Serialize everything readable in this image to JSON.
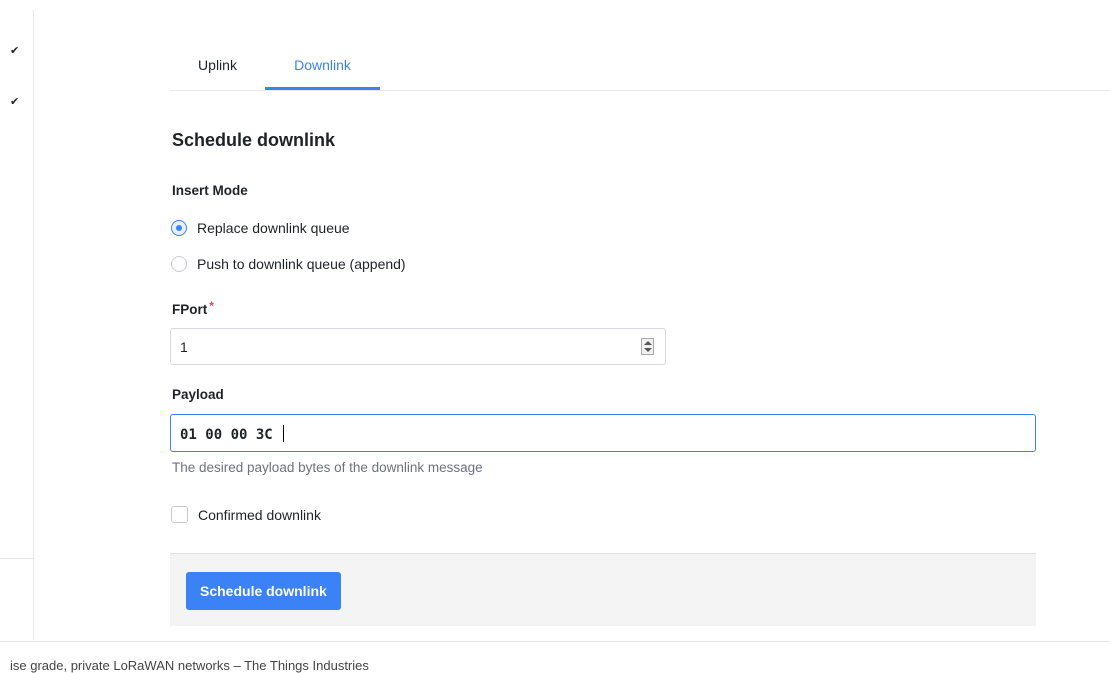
{
  "sidebar": {
    "checks": [
      "✔",
      "✔"
    ]
  },
  "tabs": [
    {
      "label": "Uplink",
      "active": false
    },
    {
      "label": "Downlink",
      "active": true
    }
  ],
  "form": {
    "title": "Schedule downlink",
    "insert_mode": {
      "label": "Insert Mode",
      "options": [
        {
          "label": "Replace downlink queue",
          "selected": true
        },
        {
          "label": "Push to downlink queue (append)",
          "selected": false
        }
      ]
    },
    "fport": {
      "label": "FPort",
      "required_mark": "*",
      "value": "1"
    },
    "payload": {
      "label": "Payload",
      "value": "01 00 00 3C ",
      "help": "The desired payload bytes of the downlink message"
    },
    "confirmed": {
      "label": "Confirmed downlink",
      "checked": false
    },
    "submit_label": "Schedule downlink"
  },
  "footer": {
    "text": "ise grade, private LoRaWAN networks – The Things Industries"
  },
  "colors": {
    "accent": "#3b82f6",
    "required": "#e5484d"
  }
}
